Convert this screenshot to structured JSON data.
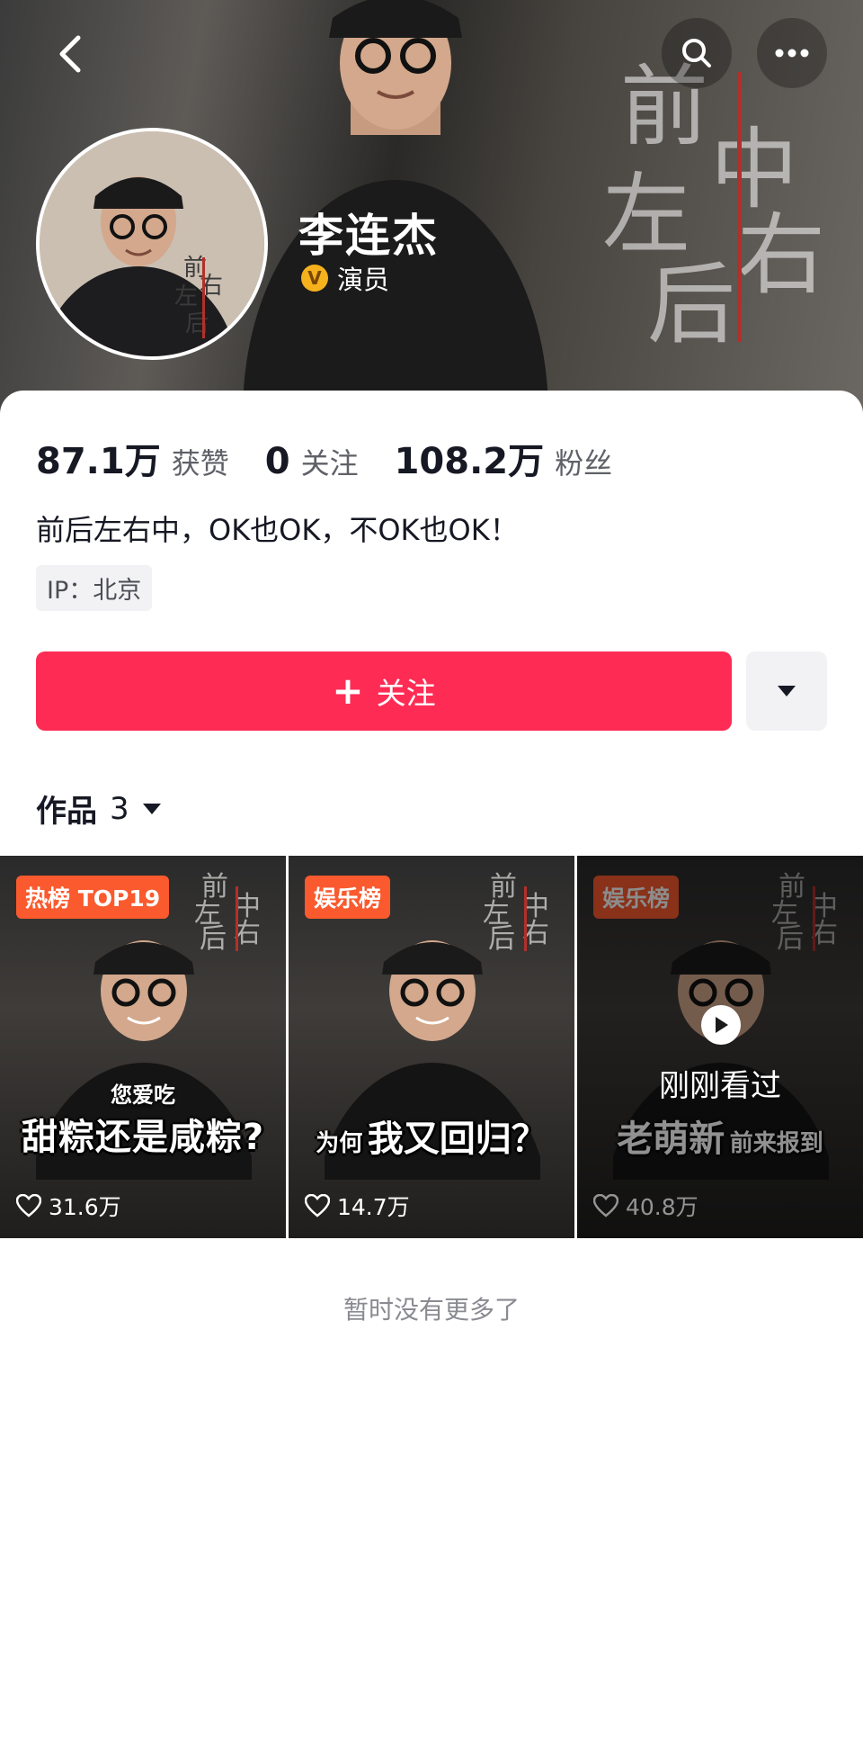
{
  "profile": {
    "name": "李连杰",
    "verify_icon": "V",
    "verify_label": "演员",
    "banner_logo_chars": [
      "前",
      "左",
      "中",
      "右",
      "后"
    ]
  },
  "stats": [
    {
      "value": "87.1万",
      "label": "获赞"
    },
    {
      "value": "0",
      "label": "关注"
    },
    {
      "value": "108.2万",
      "label": "粉丝"
    }
  ],
  "bio": "前后左右中，OK也OK，不OK也OK！",
  "ip": "IP：北京",
  "actions": {
    "follow_label": "关注",
    "follow_icon": "+"
  },
  "works": {
    "label": "作品",
    "count": "3"
  },
  "videos": [
    {
      "badge": "热榜 TOP19",
      "caption_small": "您爱吃",
      "caption_large": "甜粽还是咸粽?",
      "likes": "31.6万"
    },
    {
      "badge": "娱乐榜",
      "caption_small": "为何",
      "caption_large": "我又回归？",
      "likes": "14.7万"
    },
    {
      "badge": "娱乐榜",
      "caption_small": "前来报到",
      "caption_large": "老萌新",
      "likes": "40.8万",
      "watched": "刚刚看过"
    }
  ],
  "footer_text": "暂时没有更多了",
  "colors": {
    "accent": "#fe2c55",
    "badge": "#fa5a2e",
    "verify": "#f6b21c"
  }
}
